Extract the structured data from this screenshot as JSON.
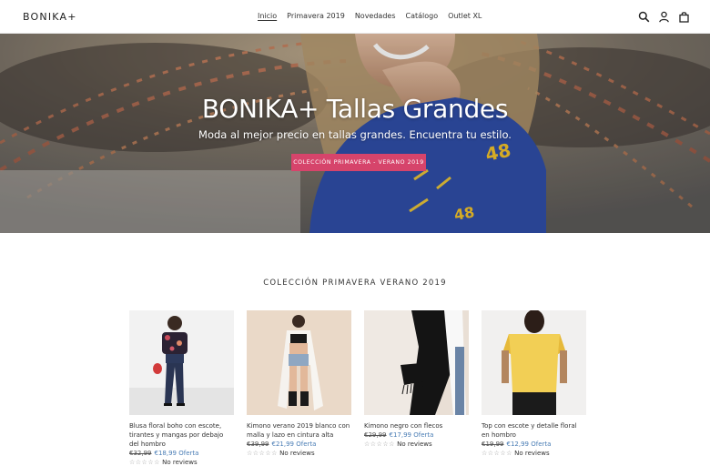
{
  "header": {
    "logo": "BONIKA+",
    "nav": [
      {
        "label": "Inicio",
        "active": true
      },
      {
        "label": "Primavera 2019",
        "active": false
      },
      {
        "label": "Novedades",
        "active": false
      },
      {
        "label": "Catálogo",
        "active": false
      },
      {
        "label": "Outlet XL",
        "active": false
      }
    ],
    "icons": [
      "search-icon",
      "account-icon",
      "cart-icon"
    ]
  },
  "hero": {
    "title": "BONIKA+ Tallas Grandes",
    "subtitle": "Moda al mejor precio en tallas grandes. Encuentra tu estilo.",
    "button_label": "COLECCIÓN PRIMAVERA - VERANO 2019",
    "button_color": "#d6446b",
    "shirt_number": "48"
  },
  "collection": {
    "title": "COLECCIÓN PRIMAVERA VERANO 2019",
    "products": [
      {
        "name": "Blusa floral boho con escote, tirantes y mangas por debajo del hombro",
        "old_price": "€32,99",
        "new_price": "€18,99 Oferta",
        "stars": "☆☆☆☆☆",
        "reviews": "No reviews"
      },
      {
        "name": "Kimono verano 2019 blanco con malla y lazo en cintura alta",
        "old_price": "€39,99",
        "new_price": "€21,99 Oferta",
        "stars": "☆☆☆☆☆",
        "reviews": "No reviews"
      },
      {
        "name": "Kimono negro con flecos",
        "old_price": "€29,99",
        "new_price": "€17,99 Oferta",
        "stars": "☆☆☆☆☆",
        "reviews": "No reviews"
      },
      {
        "name": "Top con escote y detalle floral en hombro",
        "old_price": "€19,99",
        "new_price": "€12,99 Oferta",
        "stars": "☆☆☆☆☆",
        "reviews": "No reviews"
      }
    ]
  },
  "colors": {
    "accent": "#d6446b",
    "sale_price": "#4a7db5"
  }
}
